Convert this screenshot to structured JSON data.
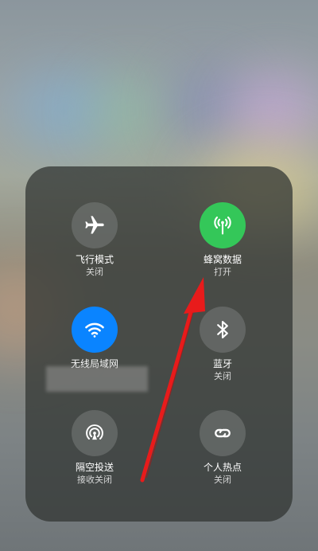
{
  "controls": [
    {
      "name": "airplane-mode",
      "label": "飞行模式",
      "status": "关闭"
    },
    {
      "name": "cellular-data",
      "label": "蜂窝数据",
      "status": "打开"
    },
    {
      "name": "wifi",
      "label": "无线局域网",
      "status": ""
    },
    {
      "name": "bluetooth",
      "label": "蓝牙",
      "status": "关闭"
    },
    {
      "name": "airdrop",
      "label": "隔空投送",
      "status": "接收关闭"
    },
    {
      "name": "personal-hotspot",
      "label": "个人热点",
      "status": "关闭"
    }
  ],
  "colors": {
    "cellular_on": "#34c759",
    "wifi_on": "#0a84ff",
    "annotation_arrow": "#e81b1b"
  },
  "icons": {
    "airplane": "airplane-icon",
    "cellular": "antenna-icon",
    "wifi": "wifi-icon",
    "bluetooth": "bluetooth-icon",
    "airdrop": "airdrop-icon",
    "hotspot": "link-chain-icon"
  }
}
